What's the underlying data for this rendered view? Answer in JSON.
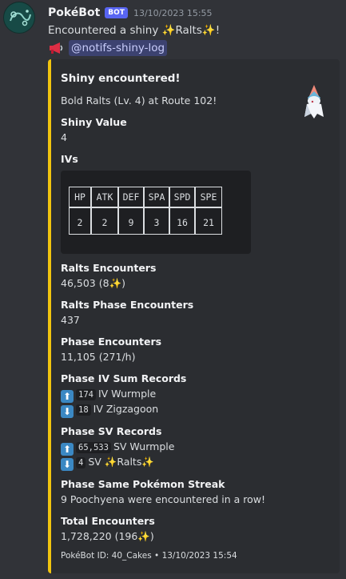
{
  "message": {
    "username": "PokéBot",
    "bot_badge": "BOT",
    "timestamp": "13/10/2023 15:55",
    "content_before": "Encountered a shiny ",
    "content_pokemon": "Ralts",
    "content_after": "!",
    "mention": "@notifs-shiny-log"
  },
  "embed": {
    "title": "Shiny encountered!",
    "description": "Bold Ralts (Lv. 4) at Route 102!",
    "shiny_value": {
      "name": "Shiny Value",
      "value": "4"
    },
    "ivs": {
      "name": "IVs",
      "headers": [
        "HP",
        "ATK",
        "DEF",
        "SPA",
        "SPD",
        "SPE"
      ],
      "values": [
        "2",
        "2",
        "9",
        "3",
        "16",
        "21"
      ]
    },
    "ralts_encounters": {
      "name": "Ralts Encounters",
      "value_before": "46,503 (8",
      "value_after": ")"
    },
    "ralts_phase": {
      "name": "Ralts Phase Encounters",
      "value": "437"
    },
    "phase_encounters": {
      "name": "Phase Encounters",
      "value": "11,105 (271/h)"
    },
    "iv_records": {
      "name": "Phase IV Sum Records",
      "high_value": "174",
      "high_text": "IV Wurmple",
      "low_value": "18",
      "low_text": "IV Zigzagoon"
    },
    "sv_records": {
      "name": "Phase SV Records",
      "high_value": "65,533",
      "high_text": "SV Wurmple",
      "low_value": "4",
      "low_text_before": "SV ",
      "low_pokemon": "Ralts"
    },
    "streak": {
      "name": "Phase Same Pokémon Streak",
      "value": "9 Poochyena were encountered in a row!"
    },
    "total": {
      "name": "Total Encounters",
      "value_before": "1,728,220 (196",
      "value_after": ")"
    },
    "footer": "PokéBot ID: 40_Cakes • 13/10/2023 15:54"
  },
  "colors": {
    "embed_accent": "#f1c40f",
    "mention_bg": "#3c4270",
    "bot_badge": "#5865f2"
  },
  "icons": [
    "sparkles-icon",
    "megaphone-icon",
    "arrow-up-icon",
    "arrow-down-icon",
    "ralts-sprite"
  ]
}
